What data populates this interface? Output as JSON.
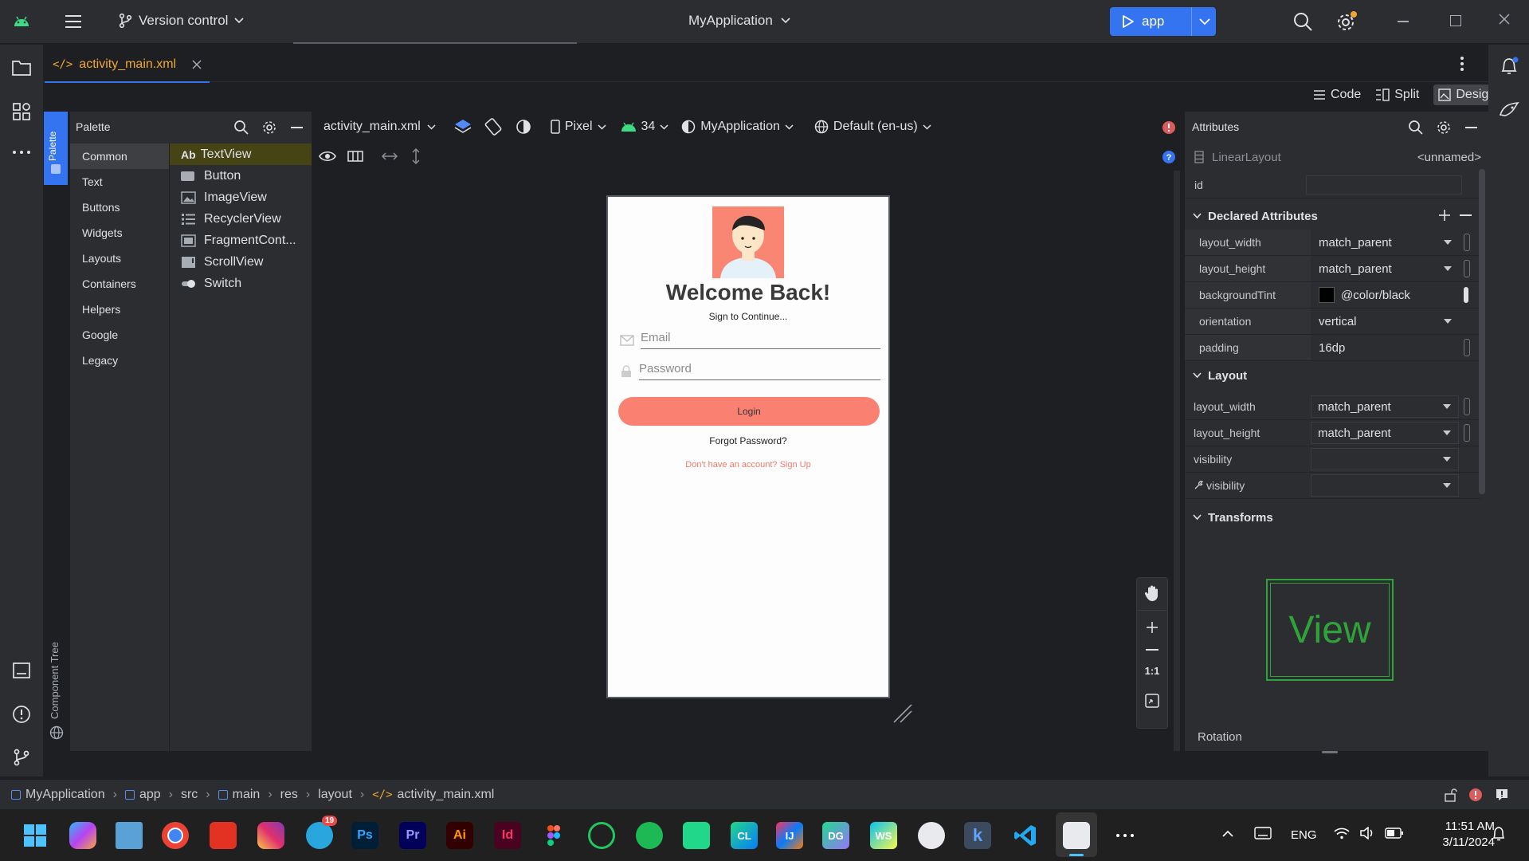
{
  "titlebar": {
    "vcs_label": "Version control",
    "project_title": "MyApplication",
    "run_config": "app"
  },
  "tab": {
    "label": "activity_main.xml"
  },
  "view_modes": {
    "code": "Code",
    "split": "Split",
    "design": "Design"
  },
  "palette": {
    "title": "Palette",
    "vtab_label": "Palette",
    "categories": [
      "Common",
      "Text",
      "Buttons",
      "Widgets",
      "Layouts",
      "Containers",
      "Helpers",
      "Google",
      "Legacy"
    ],
    "items": [
      "TextView",
      "Button",
      "ImageView",
      "RecyclerView",
      "FragmentCont...",
      "ScrollView",
      "Switch"
    ],
    "textview_prefix": "Ab"
  },
  "component_tree_label": "Component Tree",
  "design_toolbar": {
    "file": "activity_main.xml",
    "device": "Pixel",
    "api": "34",
    "theme": "MyApplication",
    "locale": "Default (en-us)"
  },
  "preview": {
    "title": "Welcome Back!",
    "subtitle": "Sign to Continue...",
    "email_hint": "Email",
    "password_hint": "Password",
    "login_label": "Login",
    "forgot": "Forgot Password?",
    "signup": "Don't have an account? Sign Up"
  },
  "zoom": {
    "one_to_one": "1:1"
  },
  "attributes": {
    "title": "Attributes",
    "component": "LinearLayout",
    "component_name": "<unnamed>",
    "id_label": "id",
    "declared_title": "Declared Attributes",
    "declared": [
      {
        "key": "layout_width",
        "value": "match_parent"
      },
      {
        "key": "layout_height",
        "value": "match_parent"
      },
      {
        "key": "backgroundTint",
        "value": "@color/black"
      },
      {
        "key": "orientation",
        "value": "vertical"
      },
      {
        "key": "padding",
        "value": "16dp"
      }
    ],
    "layout_title": "Layout",
    "layout": [
      {
        "key": "layout_width",
        "value": "match_parent"
      },
      {
        "key": "layout_height",
        "value": "match_parent"
      },
      {
        "key": "visibility",
        "value": ""
      },
      {
        "key": "visibility",
        "value": ""
      }
    ],
    "transforms_title": "Transforms",
    "view_preview": "View",
    "rotation_label": "Rotation"
  },
  "breadcrumb": [
    "MyApplication",
    "app",
    "src",
    "main",
    "res",
    "layout",
    "activity_main.xml"
  ],
  "taskbar": {
    "apps": [
      "Ps",
      "Pr",
      "Ai",
      "Id",
      "CL",
      "IJ",
      "DG",
      "WS",
      "k"
    ],
    "telegram_badge": "19",
    "language": "ENG",
    "time": "11:51 AM",
    "date": "3/11/2024"
  },
  "colors": {
    "accent": "#3574f0",
    "coral": "#fa8072",
    "warning_red": "#db5c5c",
    "android_green": "#3ddc84",
    "palette_highlight": "#464415"
  }
}
